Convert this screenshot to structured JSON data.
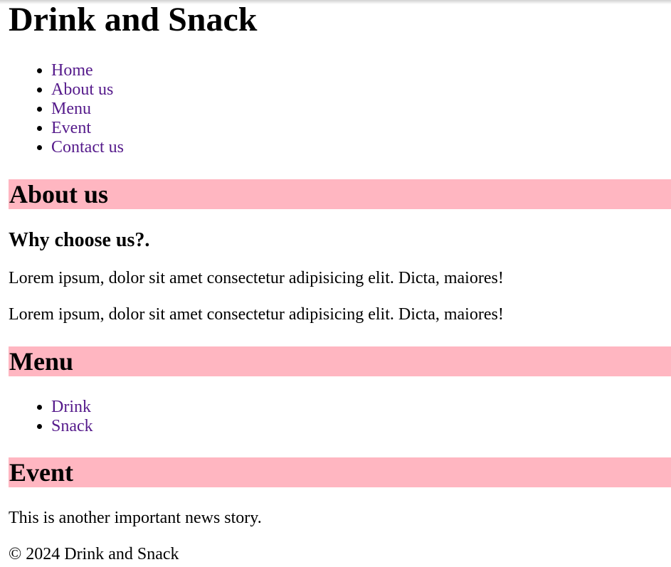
{
  "site_title": "Drink and Snack",
  "nav": [
    "Home",
    "About us",
    "Menu",
    "Event",
    "Contact us"
  ],
  "about": {
    "heading": "About us",
    "subheading": "Why choose us?.",
    "paragraphs": [
      "Lorem ipsum, dolor sit amet consectetur adipisicing elit. Dicta, maiores!",
      "Lorem ipsum, dolor sit amet consectetur adipisicing elit. Dicta, maiores!"
    ]
  },
  "menu": {
    "heading": "Menu",
    "items": [
      "Drink",
      "Snack"
    ]
  },
  "event": {
    "heading": "Event",
    "text": "This is another important news story."
  },
  "footer": "© 2024 Drink and Snack",
  "colors": {
    "section_header_bg": "#ffb6c1",
    "link": "#551a8b"
  }
}
